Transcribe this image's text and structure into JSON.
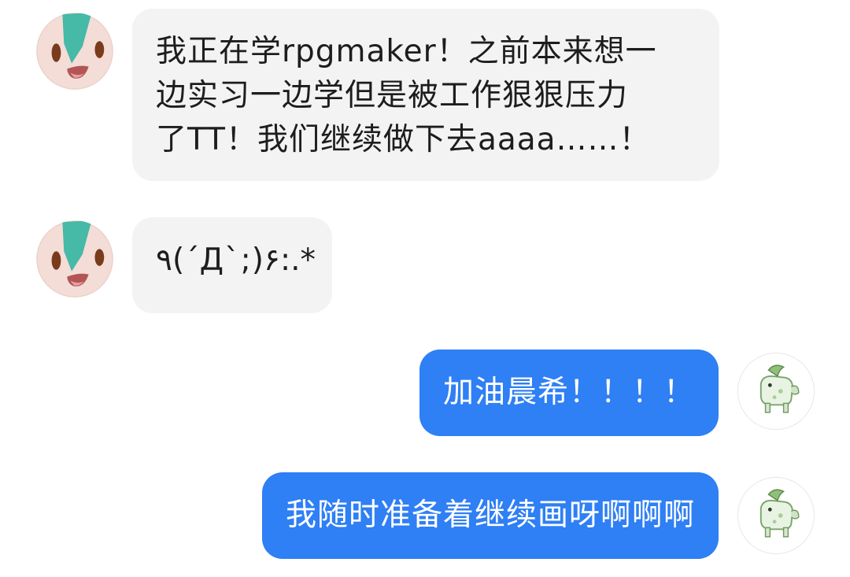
{
  "colors": {
    "incoming_bubble": "#f3f3f3",
    "outgoing_bubble": "#2f7ff5",
    "incoming_text": "#1d1d1d",
    "outgoing_text": "#ffffff"
  },
  "icons": {
    "incoming_avatar": "round-face-avatar-icon",
    "outgoing_avatar": "green-creature-avatar-icon"
  },
  "messages": [
    {
      "direction": "incoming",
      "lines": [
        "我正在学rpgmaker！之前本来想一",
        "边实习一边学但是被工作狠狠压力",
        "了TT！我们继续做下去aaaa……！"
      ]
    },
    {
      "direction": "incoming",
      "lines": [
        "٩(´Д`;)۶:.*"
      ]
    },
    {
      "direction": "outgoing",
      "lines": [
        "加油晨希！！！！"
      ]
    },
    {
      "direction": "outgoing",
      "lines": [
        "我随时准备着继续画呀啊啊啊"
      ]
    }
  ]
}
